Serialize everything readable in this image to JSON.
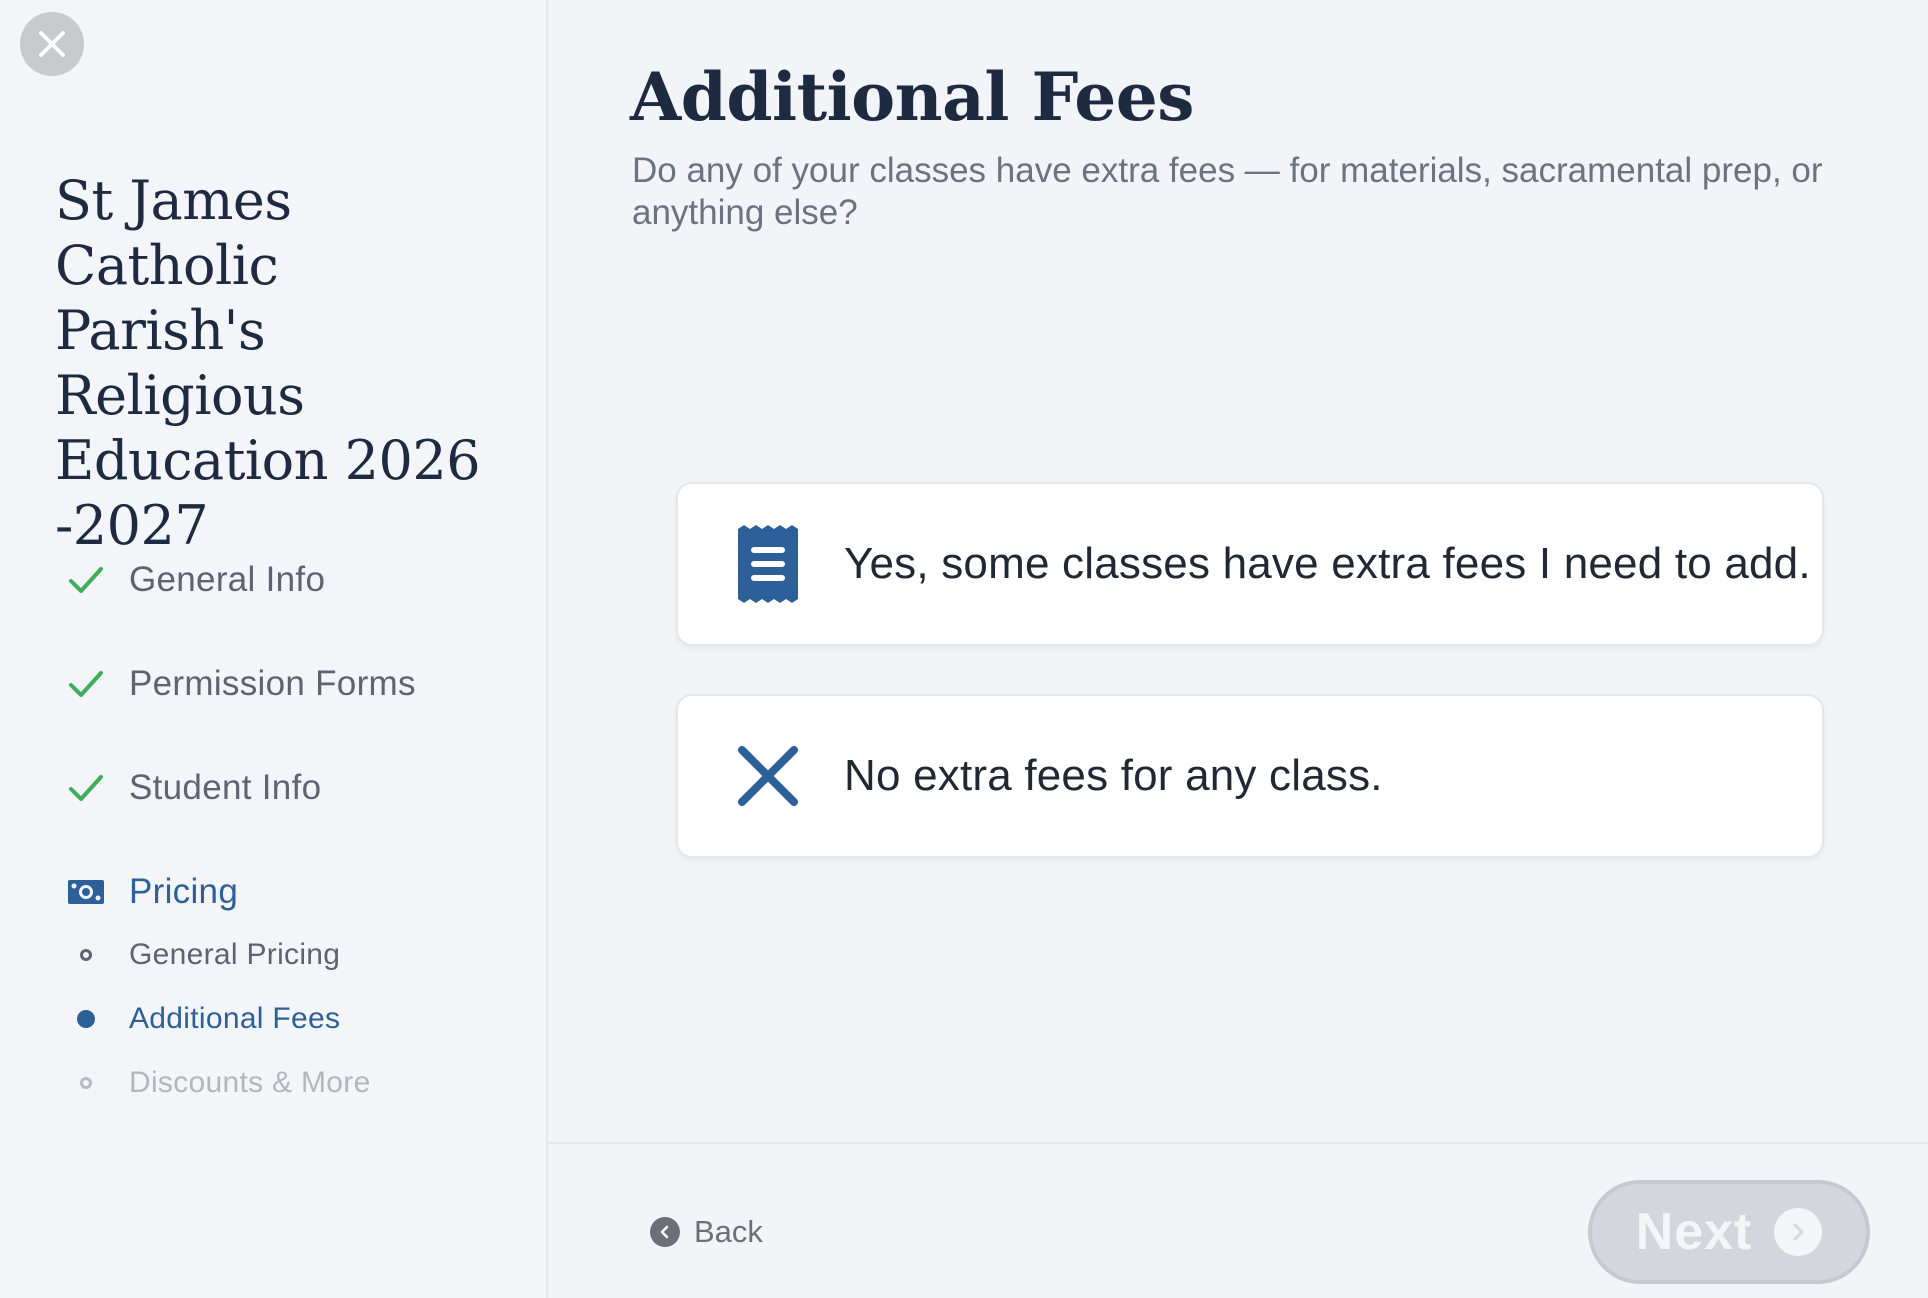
{
  "sidebar": {
    "title": "St James Catholic Parish's Religious Education 2026 -2027",
    "steps": [
      {
        "label": "General Info",
        "status": "complete",
        "icon": "checkmark-icon"
      },
      {
        "label": "Permission Forms",
        "status": "complete",
        "icon": "checkmark-icon"
      },
      {
        "label": "Student Info",
        "status": "complete",
        "icon": "checkmark-icon"
      },
      {
        "label": "Pricing",
        "status": "active",
        "icon": "money-bill-icon"
      }
    ],
    "substeps": [
      {
        "label": "General Pricing",
        "status": "visited"
      },
      {
        "label": "Additional Fees",
        "status": "current"
      },
      {
        "label": "Discounts & More",
        "status": "upcoming"
      }
    ]
  },
  "main": {
    "title": "Additional Fees",
    "subtitle": "Do any of your classes have extra fees — for materials, sacramental prep, or anything else?",
    "options": [
      {
        "label": "Yes, some classes have extra fees I need to add.",
        "icon": "receipt-icon"
      },
      {
        "label": "No extra fees for any class.",
        "icon": "x-icon"
      }
    ]
  },
  "footer": {
    "back_label": "Back",
    "next_label": "Next",
    "next_enabled": false
  },
  "colors": {
    "accent": "#2d5f98",
    "check": "#3fae5a",
    "heading": "#1d2a40",
    "disabled_button": "#d3d6dc"
  }
}
